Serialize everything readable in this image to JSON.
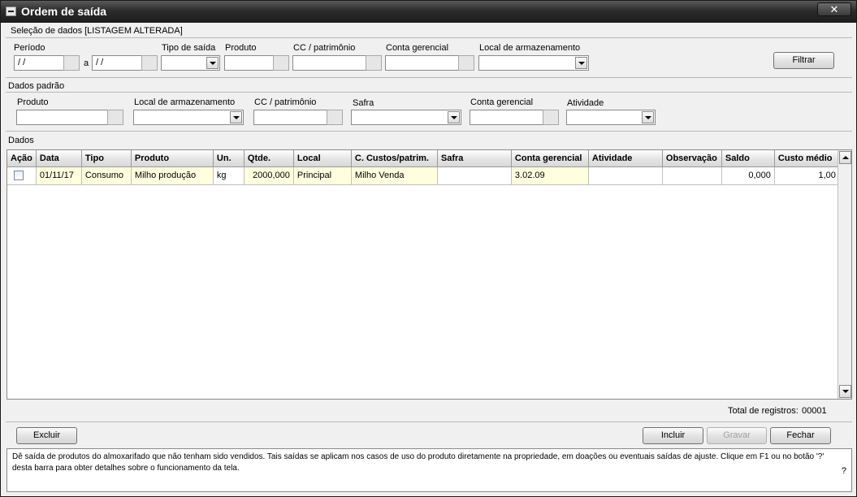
{
  "window": {
    "title": "Ordem de saída",
    "close_glyph": "✕"
  },
  "filter": {
    "section_label": "Seleção de dados [LISTAGEM ALTERADA]",
    "periodo_label": "Período",
    "periodo_from": " / /",
    "periodo_sep": "a",
    "periodo_to": " / /",
    "tipo_label": "Tipo de saída",
    "produto_label": "Produto",
    "cc_label": "CC / patrimônio",
    "conta_label": "Conta gerencial",
    "local_label": "Local de armazenamento",
    "filtrar_button": "Filtrar"
  },
  "defaults": {
    "section_label": "Dados padrão",
    "produto_label": "Produto",
    "local_label": "Local de armazenamento",
    "cc_label": "CC / patrimônio",
    "safra_label": "Safra",
    "conta_label": "Conta gerencial",
    "atividade_label": "Atividade"
  },
  "data": {
    "section_label": "Dados",
    "columns": [
      "Ação",
      "Data",
      "Tipo",
      "Produto",
      "Un.",
      "Qtde.",
      "Local",
      "C. Custos/patrim.",
      "Safra",
      "Conta gerencial",
      "Atividade",
      "Observação",
      "Saldo",
      "Custo médio"
    ],
    "rows": [
      {
        "data": "01/11/17",
        "tipo": "Consumo",
        "produto": "Milho produção",
        "un": "kg",
        "qtde": "2000,000",
        "local": "Principal",
        "cc": "Milho Venda",
        "safra": "",
        "conta": "3.02.09",
        "atividade": "",
        "observacao": "",
        "saldo": "0,000",
        "custo_medio": "1,00"
      }
    ],
    "total_label": "Total de registros:",
    "total_value": "00001"
  },
  "buttons": {
    "excluir": "Excluir",
    "incluir": "Incluir",
    "gravar": "Gravar",
    "fechar": "Fechar"
  },
  "help": {
    "text": "Dê saída de produtos do almoxarifado que não tenham sido vendidos. Tais saídas se aplicam nos casos de uso do produto diretamente na propriedade, em doações ou eventuais saídas de ajuste. Clique em F1 ou no botão '?' desta barra para obter detalhes sobre o funcionamento da tela.",
    "question_mark": "?"
  },
  "colors": {
    "titlebar": "#2c2c2c",
    "row_highlight": "#ffffe0",
    "window_bg": "#f0f0f0"
  },
  "icons": [
    "system-menu-icon",
    "close-icon",
    "combo-arrow-icon",
    "scroll-up-icon",
    "scroll-down-icon",
    "checkbox-icon"
  ]
}
